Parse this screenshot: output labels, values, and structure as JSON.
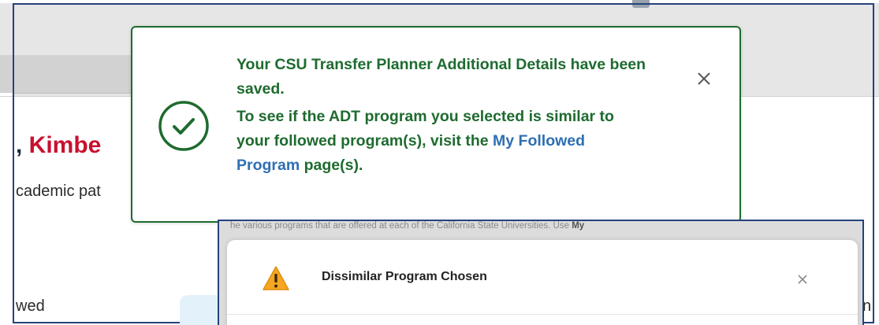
{
  "background": {
    "greeting_prefix": ", ",
    "greeting_name": "Kimbe",
    "subtitle": "cademic pat",
    "followed_label": "wed",
    "right_snippet": "n"
  },
  "toast": {
    "line1": "Your CSU Transfer Planner Additional Details have been saved.",
    "line2_prefix": "To see if the ADT program you selected is similar to your followed program(s), visit the ",
    "link_text": "My Followed Program",
    "line2_suffix": " page(s).",
    "icon": "check-circle-icon",
    "close_icon": "close-icon",
    "accent_color": "#1e6b2f",
    "link_color": "#2e6fb3"
  },
  "dialog": {
    "faded_text": "he various programs that are offered at each of the California State Universities. Use",
    "faded_bold": "My",
    "title": "Dissimilar Program Chosen",
    "icon": "warning-icon",
    "close_icon": "close-icon",
    "warning_color": "#f5a623"
  }
}
